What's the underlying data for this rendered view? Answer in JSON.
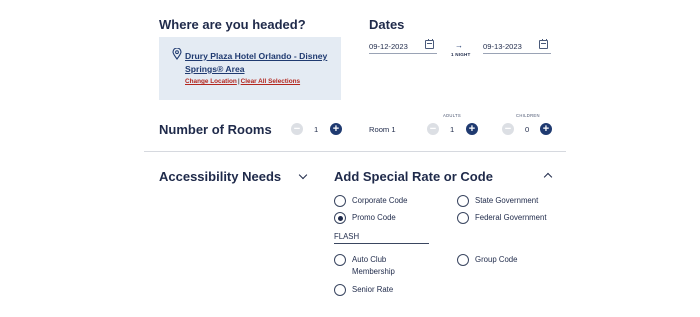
{
  "destination": {
    "heading": "Where are you headed?",
    "hotel_name": "Drury Plaza Hotel Orlando - Disney Springs® Area",
    "change_location": "Change Location",
    "separator": "|",
    "clear_all": "Clear All Selections",
    "pin_icon": "map-pin-icon"
  },
  "dates": {
    "heading": "Dates",
    "check_in": "09-12-2023",
    "check_out": "09-13-2023",
    "arrow": "→",
    "nights": "1 NIGHT",
    "calendar_icon": "calendar-icon"
  },
  "rooms": {
    "heading": "Number of Rooms",
    "count": "1",
    "room_label": "Room 1",
    "adults_label": "ADULTS",
    "adults": "1",
    "children_label": "CHILDREN",
    "children": "0",
    "minus": "−",
    "plus": "+"
  },
  "accessibility": {
    "heading": "Accessibility Needs",
    "expanded": false
  },
  "special_rate": {
    "heading": "Add Special Rate or Code",
    "expanded": true,
    "options": [
      {
        "label": "Corporate Code",
        "selected": false
      },
      {
        "label": "State Government",
        "selected": false
      },
      {
        "label": "Promo Code",
        "selected": true
      },
      {
        "label": "Federal Government",
        "selected": false
      },
      {
        "label": "Auto Club Membership",
        "selected": false
      },
      {
        "label": "Group Code",
        "selected": false
      },
      {
        "label": "Senior Rate",
        "selected": false
      }
    ],
    "promo_value": "FLASH"
  },
  "colors": {
    "navy": "#1f2a4a",
    "accent_blue": "#1f3a70",
    "link_red": "#b3261e",
    "location_bg": "#e4ebf3"
  }
}
